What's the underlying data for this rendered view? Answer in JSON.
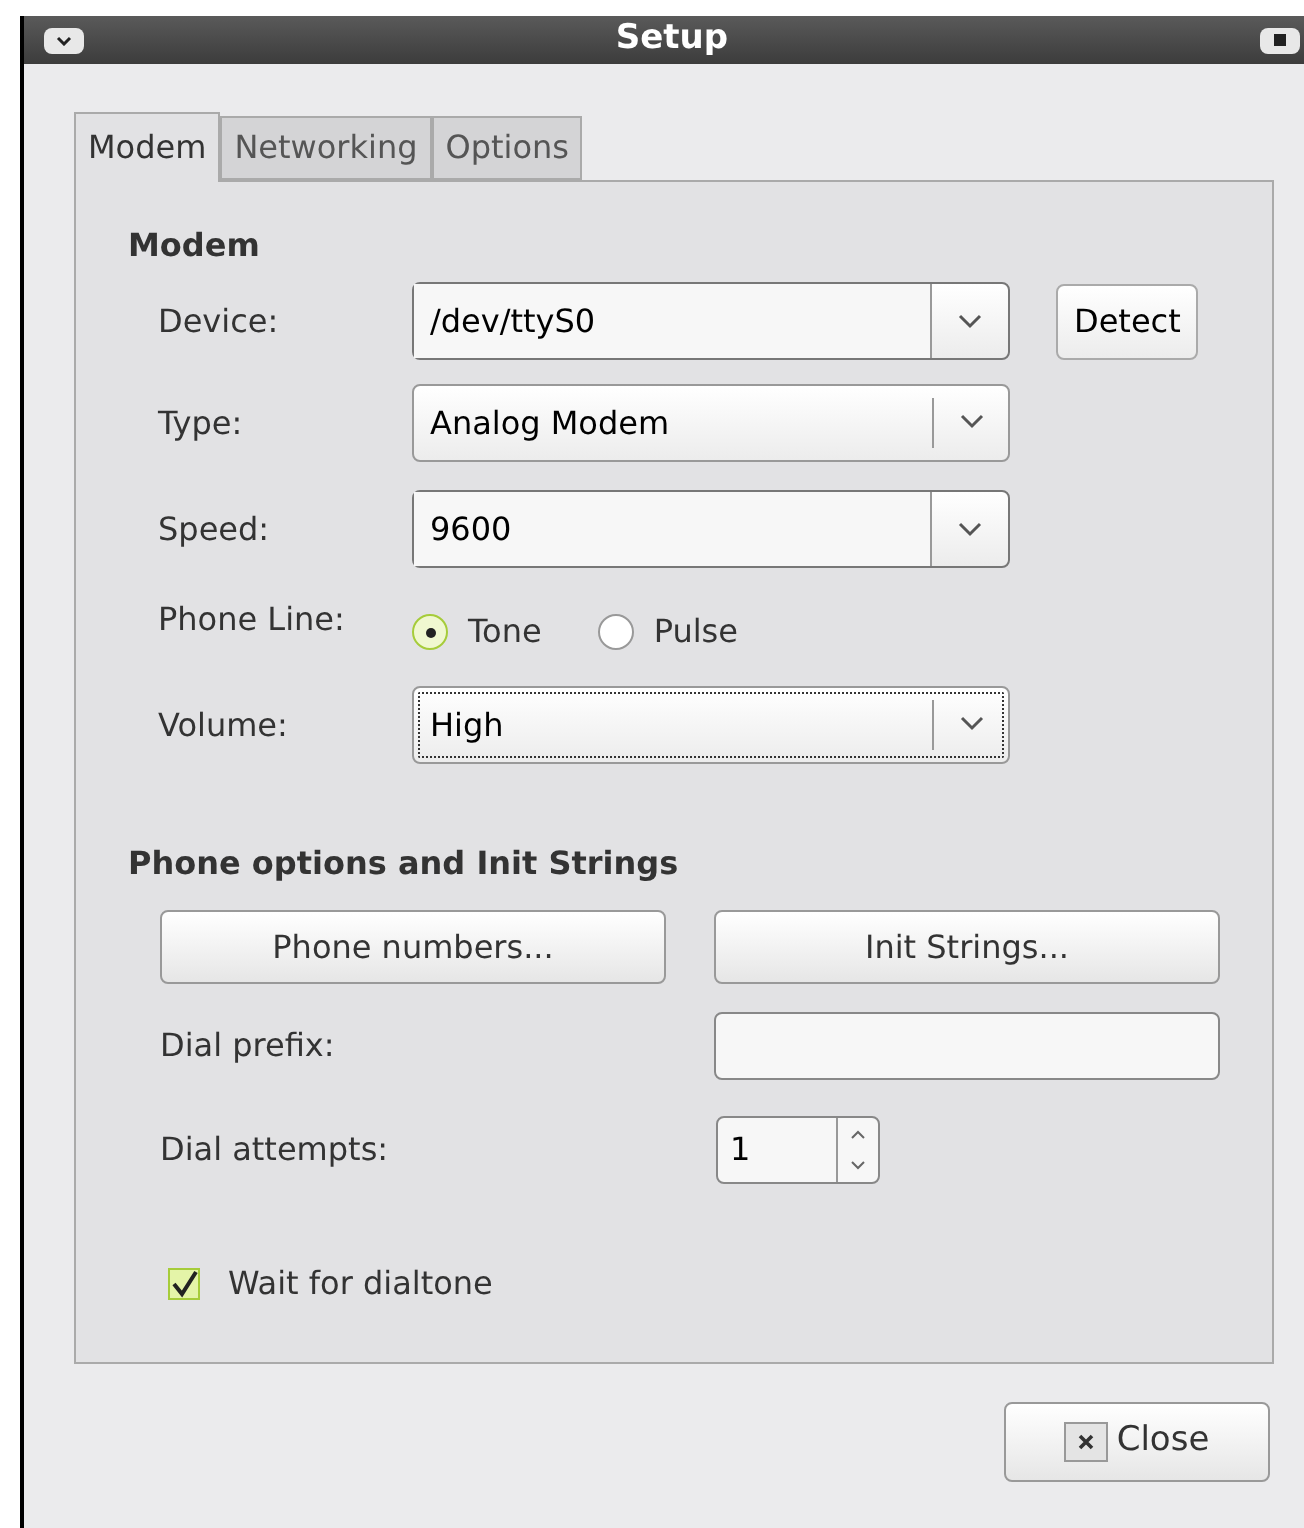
{
  "window": {
    "title": "Setup"
  },
  "tabs": [
    {
      "label": "Modem",
      "selected": true
    },
    {
      "label": "Networking",
      "selected": false
    },
    {
      "label": "Options",
      "selected": false
    }
  ],
  "modem": {
    "heading": "Modem",
    "device": {
      "label": "Device:",
      "value": "/dev/ttyS0",
      "button": "Detect"
    },
    "type": {
      "label": "Type:",
      "value": "Analog Modem"
    },
    "speed": {
      "label": "Speed:",
      "value": "9600"
    },
    "phone_line": {
      "label": "Phone Line:",
      "options": [
        {
          "label": "Tone",
          "selected": true
        },
        {
          "label": "Pulse",
          "selected": false
        }
      ]
    },
    "volume": {
      "label": "Volume:",
      "value": "High",
      "focused": true
    }
  },
  "phone_options": {
    "heading": "Phone options and Init Strings",
    "buttons": [
      "Phone numbers...",
      "Init Strings..."
    ],
    "dial_prefix": {
      "label": "Dial prefix:"
    },
    "dial_attempts": {
      "label": "Dial attempts:",
      "value": "1"
    },
    "wait_for_dialtone": {
      "label": "Wait for dialtone",
      "checked": true
    }
  },
  "close_button": "Close"
}
